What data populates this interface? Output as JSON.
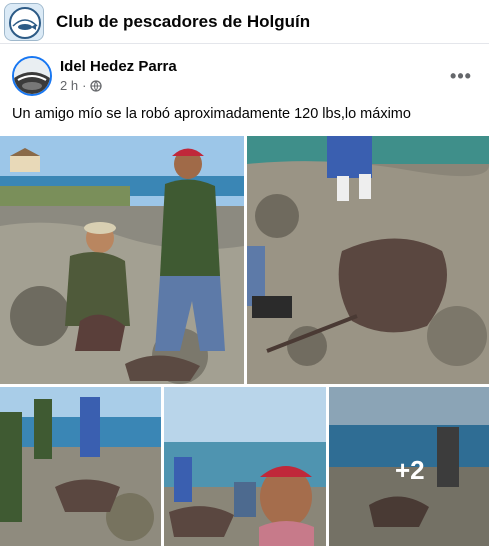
{
  "group": {
    "name": "Club de pescadores de Holguín",
    "logo_icon": "club-logo-icon"
  },
  "post": {
    "author": "Idel Hedez Parra",
    "time": "2 h",
    "separator": "·",
    "privacy_icon": "globe-icon",
    "more_icon": "more-options-icon",
    "more_label": "•••",
    "text": "Un amigo mío se la robó aproximadamente 120 lbs,lo máximo"
  },
  "photos": {
    "extra_count": "+2"
  },
  "colors": {
    "accent": "#1877f2",
    "text_primary": "#050505",
    "text_secondary": "#65676b"
  }
}
